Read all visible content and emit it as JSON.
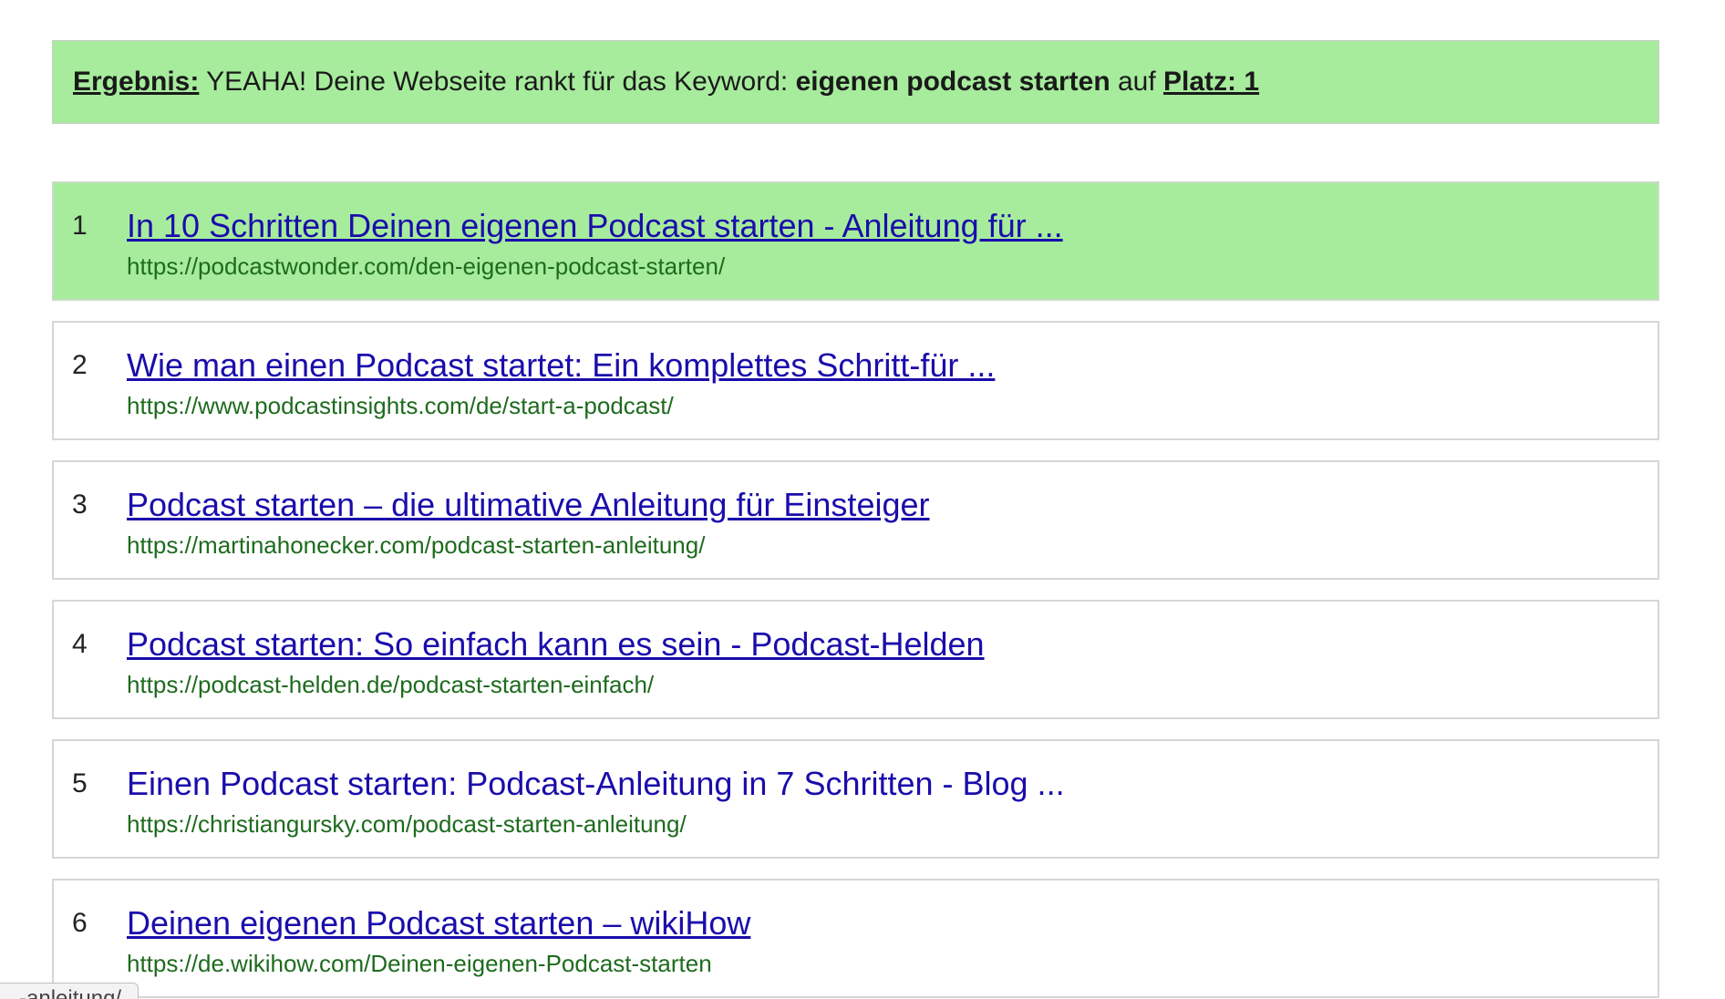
{
  "banner": {
    "label": "Ergebnis:",
    "text1": " YEAHA! Deine Webseite rankt für das Keyword: ",
    "keyword": "eigenen podcast starten",
    "text2": " auf ",
    "place": "Platz: 1"
  },
  "results": [
    {
      "rank": "1",
      "title": "In 10 Schritten Deinen eigenen Podcast starten - Anleitung für ...",
      "url": "https://podcastwonder.com/den-eigenen-podcast-starten/"
    },
    {
      "rank": "2",
      "title": "Wie man einen Podcast startet: Ein komplettes Schritt-für ...",
      "url": "https://www.podcastinsights.com/de/start-a-podcast/"
    },
    {
      "rank": "3",
      "title": "Podcast starten – die ultimative Anleitung für Einsteiger",
      "url": "https://martinahonecker.com/podcast-starten-anleitung/"
    },
    {
      "rank": "4",
      "title": "Podcast starten: So einfach kann es sein - Podcast-Helden",
      "url": "https://podcast-helden.de/podcast-starten-einfach/"
    },
    {
      "rank": "5",
      "title": "Einen Podcast starten: Podcast-Anleitung in 7 Schritten - Blog ...",
      "url": "https://christiangursky.com/podcast-starten-anleitung/"
    },
    {
      "rank": "6",
      "title": "Deinen eigenen Podcast starten – wikiHow",
      "url": "https://de.wikihow.com/Deinen-eigenen-Podcast-starten"
    }
  ],
  "status_tooltip": "...-anleitung/",
  "colors": {
    "highlight_green": "#a6ec9c",
    "link_blue": "#1a0dab",
    "url_green": "#1e6b1e"
  }
}
